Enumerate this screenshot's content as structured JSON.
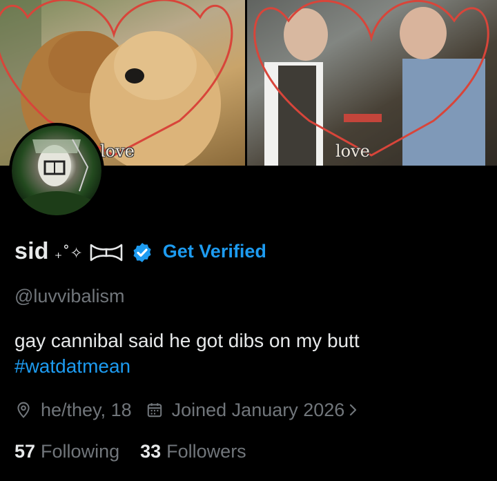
{
  "banner": {
    "left_caption": "love",
    "right_caption": "love"
  },
  "profile": {
    "display_name": "sid",
    "name_decorations": "₊˚✧",
    "verified_icon": "verified-badge-icon",
    "get_verified_label": "Get Verified",
    "handle": "@luvvibalism",
    "bio": "gay cannibal said he got dibs on my butt",
    "bio_hashtag": "#watdatmean",
    "pronouns_age": "he/they, 18",
    "joined": "Joined January 2026",
    "following_count": "57",
    "following_label": "Following",
    "followers_count": "33",
    "followers_label": "Followers"
  },
  "colors": {
    "background": "#000000",
    "text_primary": "#e7e9ea",
    "text_secondary": "#71767b",
    "accent": "#1d9bf0"
  }
}
